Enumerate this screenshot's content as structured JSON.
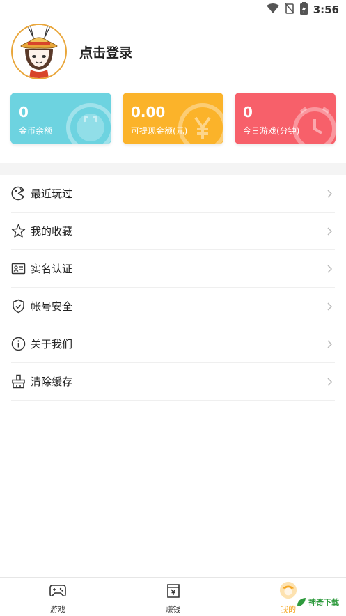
{
  "status_bar": {
    "time": "3:56",
    "icons": [
      "wifi-icon",
      "no-signal-icon",
      "battery-charging-icon"
    ]
  },
  "profile": {
    "login_prompt": "点击登录",
    "avatar": "cartoon-avatar"
  },
  "stats": [
    {
      "value": "0",
      "label": "金币余额",
      "color": "#6dd3e0",
      "icon": "rabbit-coin-icon"
    },
    {
      "value": "0.00",
      "label": "可提现金额(元)",
      "color": "#fbb32a",
      "icon": "yen-coin-icon"
    },
    {
      "value": "0",
      "label": "今日游戏(分钟)",
      "color": "#f7606a",
      "icon": "clock-icon"
    }
  ],
  "menu": [
    {
      "label": "最近玩过",
      "icon": "recent-game-icon"
    },
    {
      "label": "我的收藏",
      "icon": "star-icon"
    },
    {
      "label": "实名认证",
      "icon": "id-card-icon"
    },
    {
      "label": "帐号安全",
      "icon": "shield-check-icon"
    },
    {
      "label": "关于我们",
      "icon": "info-icon"
    },
    {
      "label": "清除缓存",
      "icon": "broom-icon"
    }
  ],
  "bottom_nav": [
    {
      "label": "游戏",
      "icon": "gamepad-icon",
      "active": false
    },
    {
      "label": "赚钱",
      "icon": "money-bag-icon",
      "active": false
    },
    {
      "label": "我的",
      "icon": "avatar-nav-icon",
      "active": true
    }
  ],
  "watermark": {
    "text": "神奇下载"
  }
}
